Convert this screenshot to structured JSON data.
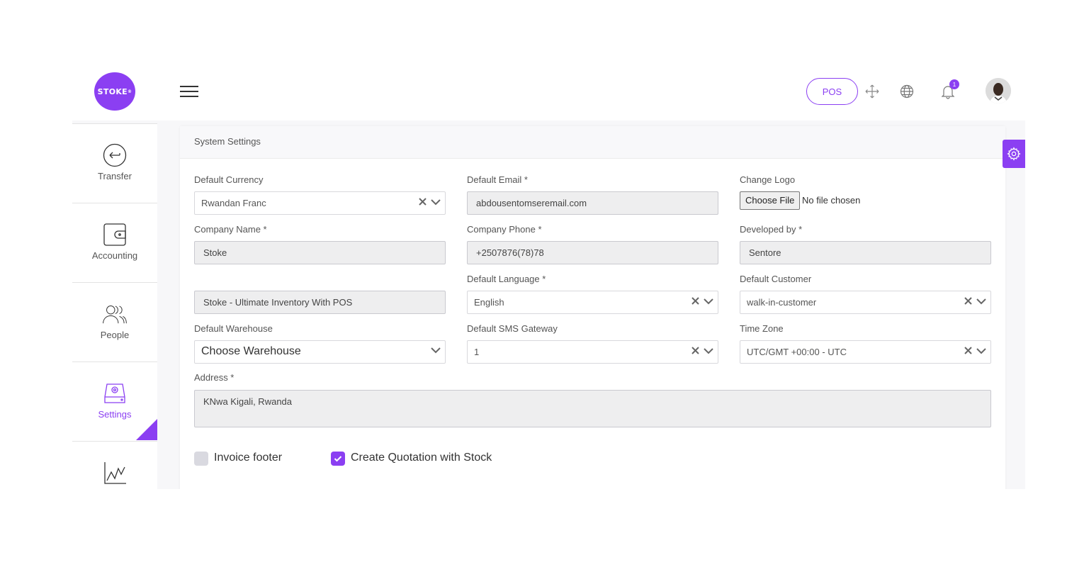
{
  "header": {
    "logo_text": "STOKE",
    "logo_mark": "®",
    "pos_label": "POS",
    "notification_count": "1",
    "icons": [
      "menu-icon",
      "fullscreen-icon",
      "globe-icon",
      "bell-icon"
    ]
  },
  "sidebar": {
    "items": [
      {
        "label": "Transfer",
        "icon": "transfer-icon"
      },
      {
        "label": "Accounting",
        "icon": "wallet-icon"
      },
      {
        "label": "People",
        "icon": "people-icon"
      },
      {
        "label": "Settings",
        "icon": "settings-icon"
      },
      {
        "label": "",
        "icon": "chart-icon"
      }
    ],
    "active": "Settings"
  },
  "card": {
    "title": "System Settings"
  },
  "form": {
    "default_currency": {
      "label": "Default Currency",
      "value": "Rwandan Franc"
    },
    "default_email": {
      "label": "Default Email *",
      "value": "abdousentomseremail.com"
    },
    "change_logo": {
      "label": "Change Logo",
      "button": "Choose File",
      "status": "No file chosen"
    },
    "company_name": {
      "label": "Company Name *",
      "value": "Stoke"
    },
    "company_phone": {
      "label": "Company Phone *",
      "value": "+2507876(78)78"
    },
    "developed_by": {
      "label": "Developed by *",
      "value": "Sentore"
    },
    "footer_text": {
      "value": "Stoke - Ultimate Inventory With POS"
    },
    "default_language": {
      "label": "Default Language *",
      "value": "English"
    },
    "default_customer": {
      "label": "Default Customer",
      "value": "walk-in-customer"
    },
    "default_warehouse": {
      "label": "Default Warehouse",
      "value": "Choose Warehouse"
    },
    "default_sms_gateway": {
      "label": "Default SMS Gateway",
      "value": "1"
    },
    "time_zone": {
      "label": "Time Zone",
      "value": "UTC/GMT +00:00 - UTC"
    },
    "address": {
      "label": "Address *",
      "value": "KNwa Kigali, Rwanda"
    },
    "invoice_footer": {
      "label": "Invoice footer",
      "checked": false
    },
    "quotation_with_stock": {
      "label": "Create Quotation with Stock",
      "checked": true
    }
  },
  "colors": {
    "accent": "#8b3ff2",
    "input_bg": "#eeeeef",
    "border": "#c9c9cf"
  }
}
